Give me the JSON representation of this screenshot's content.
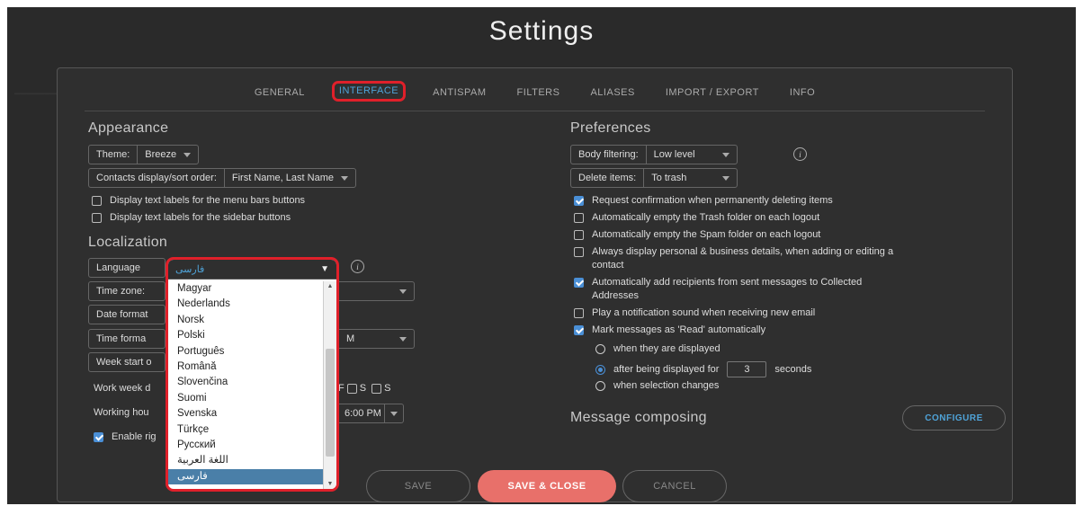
{
  "title": "Settings",
  "tabs": [
    "GENERAL",
    "INTERFACE",
    "ANTISPAM",
    "FILTERS",
    "ALIASES",
    "IMPORT / EXPORT",
    "INFO"
  ],
  "active_tab": "INTERFACE",
  "appearance": {
    "heading": "Appearance",
    "theme_label": "Theme:",
    "theme_value": "Breeze",
    "contacts_label": "Contacts display/sort order:",
    "contacts_value": "First Name, Last Name",
    "chk_menu_labels": "Display text labels for the menu bars buttons",
    "chk_sidebar_labels": "Display text labels for the sidebar buttons"
  },
  "localization": {
    "heading": "Localization",
    "language_label": "Language",
    "language_value": "فارسی",
    "timezone_label": "Time zone:",
    "dateformat_label": "Date format",
    "timeformat_label": "Time forma",
    "timeformat_value_partial": "M",
    "weekstart_label": "Week start o",
    "workweek_label": "Work week d",
    "workweek_days": [
      "F",
      "S",
      "S"
    ],
    "workinghours_label": "Working hou",
    "workinghours_value_partial": "6:00 PM",
    "enable_label": "Enable rig"
  },
  "language_options": [
    "Magyar",
    "Nederlands",
    "Norsk",
    "Polski",
    "Português",
    "Română",
    "Slovenčina",
    "Suomi",
    "Svenska",
    "Türkçe",
    "Русский",
    "اللغة العربية",
    "فارسی"
  ],
  "language_selected": "فارسی",
  "preferences": {
    "heading": "Preferences",
    "body_filtering_label": "Body filtering:",
    "body_filtering_value": "Low level",
    "delete_items_label": "Delete items:",
    "delete_items_value": "To trash",
    "opt_confirm_delete": "Request confirmation when permanently deleting items",
    "opt_empty_trash": "Automatically empty the Trash folder on each logout",
    "opt_empty_spam": "Automatically empty the Spam folder on each logout",
    "opt_personal_business_1": "Always display personal & business details, when adding or editing a",
    "opt_personal_business_2": "contact",
    "opt_collected_1": "Automatically add recipients from sent messages to Collected",
    "opt_collected_2": "Addresses",
    "opt_sound": "Play a notification sound when receiving new email",
    "opt_mark_read": "Mark messages as 'Read' automatically",
    "radio_displayed": "when they are displayed",
    "radio_after": "after being displayed for",
    "radio_after_value": "3",
    "radio_after_unit": "seconds",
    "radio_selection": "when selection changes"
  },
  "message_composing": {
    "heading": "Message composing",
    "configure_label": "CONFIGURE"
  },
  "footer": {
    "save": "SAVE",
    "save_close": "SAVE & CLOSE",
    "cancel": "CANCEL"
  },
  "colors": {
    "accent": "#4fa3d8",
    "highlight": "#e0202a",
    "save_close_bg": "#e8706a",
    "checkbox": "#4a8fd6"
  }
}
